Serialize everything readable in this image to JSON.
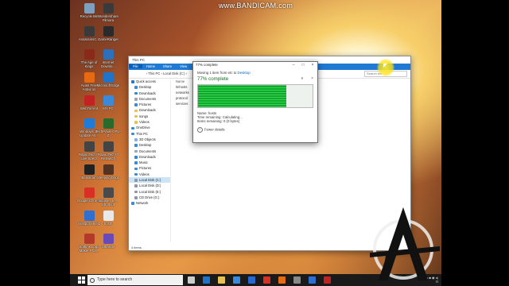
{
  "watermark": "www.BANDICAM.com",
  "desktop_icons": [
    {
      "label": "Recycle Bin",
      "icon": "recycle-bin-icon",
      "color": "#7f9fbf"
    },
    {
      "label": "Wondershare Filmora",
      "icon": "filmora-icon",
      "color": "#3a3a3a"
    },
    {
      "label": "AssassinsC...",
      "icon": "assassins-creed-icon",
      "color": "#3a3a3a"
    },
    {
      "label": "GameRanger",
      "icon": "gameranger-icon",
      "color": "#2a2a2a"
    },
    {
      "label": "The Age of Kings",
      "icon": "age-of-kings-icon",
      "color": "#8a2a1a"
    },
    {
      "label": "Internet Downlo...",
      "icon": "idm-icon",
      "color": "#2d6fb8"
    },
    {
      "label": "Avast Free Antivirus",
      "icon": "avast-icon",
      "color": "#e56a12"
    },
    {
      "label": "Microsoft Edge",
      "icon": "edge-icon",
      "color": "#1f74c8"
    },
    {
      "label": "WebTorrent",
      "icon": "webtorrent-icon",
      "color": "#c22222"
    },
    {
      "label": "MY PC",
      "icon": "my-pc-icon",
      "color": "#3b8ad9"
    },
    {
      "label": "Windows 10 Update As...",
      "icon": "windows-update-icon",
      "color": "#1e7bd8"
    },
    {
      "label": "TechPowe GPU-Z",
      "icon": "gpuz-icon",
      "color": "#2a6a2a"
    },
    {
      "label": "RapooTech™ Live Specs",
      "icon": "livespecs-icon",
      "color": "#444444"
    },
    {
      "label": "RapooTech™ ReSwitch",
      "icon": "reswitch-icon",
      "color": "#444444"
    },
    {
      "label": "Bandicam",
      "icon": "bandicam-icon",
      "color": "#222222"
    },
    {
      "label": "Sleeping Dogs",
      "icon": "sleeping-dogs-icon",
      "color": "#553322"
    },
    {
      "label": "Google Chrome",
      "icon": "chrome-icon",
      "color": "#d93025"
    },
    {
      "label": "sublime_te... Shortcut",
      "icon": "sublime-icon",
      "color": "#4a4a4a"
    },
    {
      "label": "Hotspot Shield",
      "icon": "hotspot-shield-icon",
      "color": "#2f6fd0"
    },
    {
      "label": "hosts",
      "icon": "file-icon",
      "color": "#e8e8e8"
    },
    {
      "label": "Sothink Logo Maker Prof...",
      "icon": "sothink-icon",
      "color": "#b33a2a"
    },
    {
      "label": "UltraISO",
      "icon": "ultraiso-icon",
      "color": "#6a4ab8"
    }
  ],
  "explorer": {
    "title": "This PC",
    "ribbon_tabs": [
      "File",
      "Home",
      "Share",
      "View"
    ],
    "breadcrumb": "›  This PC  ›  Local Disk (C:)  ›",
    "search_placeholder": "Search etc",
    "nav_items": [
      {
        "label": "Quick access",
        "icon": "star-icon",
        "color": "#1f7ad4",
        "head": true
      },
      {
        "label": "Desktop",
        "icon": "desktop-icon",
        "color": "#3b8ad9"
      },
      {
        "label": "Downloads",
        "icon": "downloads-icon",
        "color": "#2a8ad9"
      },
      {
        "label": "Documents",
        "icon": "documents-icon",
        "color": "#9aa4b0"
      },
      {
        "label": "Pictures",
        "icon": "pictures-icon",
        "color": "#3b8ad9"
      },
      {
        "label": "Downloads",
        "icon": "folder-icon",
        "color": "#e8c052"
      },
      {
        "label": "songs",
        "icon": "folder-icon",
        "color": "#e8c052"
      },
      {
        "label": "Videos",
        "icon": "folder-icon",
        "color": "#e8c052"
      },
      {
        "label": "OneDrive",
        "icon": "onedrive-icon",
        "color": "#2a8ad9",
        "head": true
      },
      {
        "label": "This PC",
        "icon": "this-pc-icon",
        "color": "#3b8ad9",
        "head": true
      },
      {
        "label": "3D Objects",
        "icon": "3d-objects-icon",
        "color": "#7fb2e8"
      },
      {
        "label": "Desktop",
        "icon": "desktop-icon",
        "color": "#3b8ad9"
      },
      {
        "label": "Documents",
        "icon": "documents-icon",
        "color": "#9aa4b0"
      },
      {
        "label": "Downloads",
        "icon": "downloads-icon",
        "color": "#2a8ad9"
      },
      {
        "label": "Music",
        "icon": "music-icon",
        "color": "#3b8ad9"
      },
      {
        "label": "Pictures",
        "icon": "pictures-icon",
        "color": "#3b8ad9"
      },
      {
        "label": "Videos",
        "icon": "videos-icon",
        "color": "#3b8ad9"
      },
      {
        "label": "Local Disk (C:)",
        "icon": "drive-icon",
        "color": "#8a98a8",
        "selected": true
      },
      {
        "label": "Local Disk (D:)",
        "icon": "drive-icon",
        "color": "#8a98a8"
      },
      {
        "label": "Local Disk (E:)",
        "icon": "drive-icon",
        "color": "#8a98a8"
      },
      {
        "label": "CD Drive (G:)",
        "icon": "cd-drive-icon",
        "color": "#8a98a8"
      },
      {
        "label": "Network",
        "icon": "network-icon",
        "color": "#3b8ad9",
        "head": true
      }
    ],
    "column_header": "Name",
    "files": [
      {
        "name": "lmhosts",
        "size": "4 KB"
      },
      {
        "name": "networks",
        "size": "1 KB"
      },
      {
        "name": "protocol",
        "size": "2 KB"
      },
      {
        "name": "services",
        "size": "18 KB"
      }
    ],
    "status": "4 items"
  },
  "dialog": {
    "title": "77% complete",
    "subtitle_prefix": "Moving 1 item from etc to",
    "subtitle_link": "Desktop",
    "percent_label": "77% complete",
    "progress": 0.77,
    "name_line": "Name: hosts",
    "time_line": "Time remaining: Calculating...",
    "items_line": "Items remaining: 0 (0 bytes)",
    "fewer_details": "Fewer details",
    "progress_color": "#06b025"
  },
  "taskbar": {
    "search_placeholder": "Type here to search",
    "apps": [
      {
        "icon": "task-view-icon",
        "color": "#cccccc"
      },
      {
        "icon": "edge-icon",
        "color": "#1f74c8"
      },
      {
        "icon": "file-explorer-icon",
        "color": "#e8c052"
      },
      {
        "icon": "store-icon",
        "color": "#3b8ad9"
      },
      {
        "icon": "mail-icon",
        "color": "#2a6ad0"
      },
      {
        "icon": "chrome-icon",
        "color": "#d93025"
      },
      {
        "icon": "avast-icon",
        "color": "#e56a12"
      },
      {
        "icon": "settings-icon",
        "color": "#888888"
      },
      {
        "icon": "photos-icon",
        "color": "#2f6fd0"
      },
      {
        "icon": "bandicam-icon",
        "color": "#c22222"
      }
    ]
  }
}
